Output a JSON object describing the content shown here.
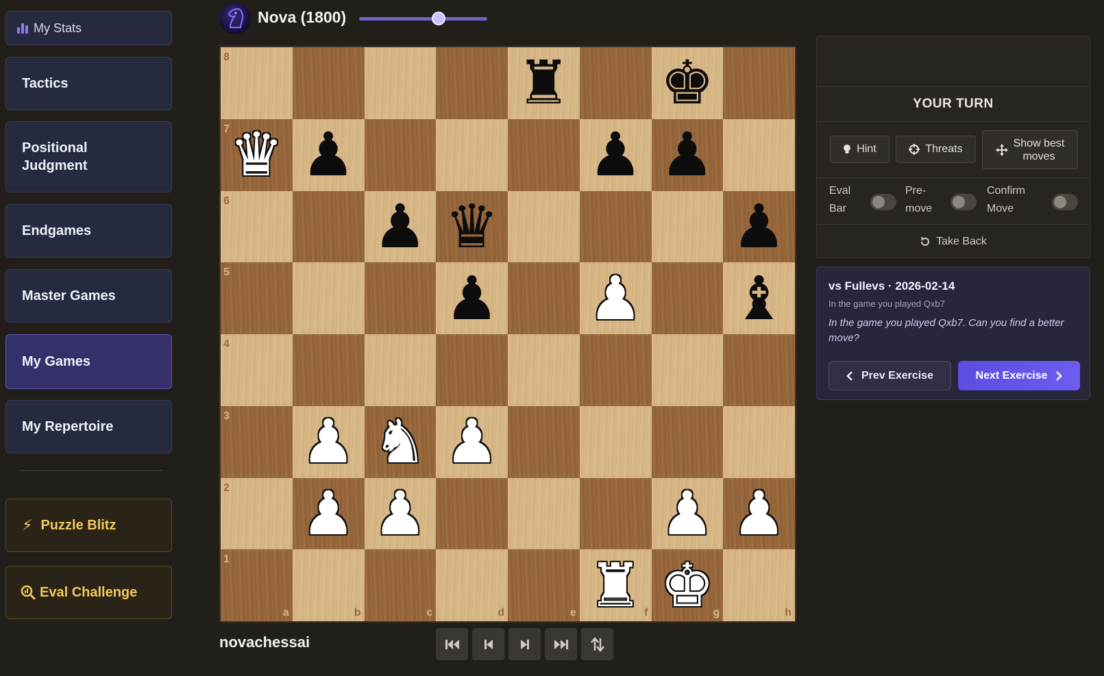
{
  "sidebar": {
    "stats_label": "My Stats",
    "items": [
      {
        "label": "Tactics"
      },
      {
        "label": "Positional Judgment"
      },
      {
        "label": "Endgames"
      },
      {
        "label": "Master Games"
      },
      {
        "label": "My Games",
        "active": true
      },
      {
        "label": "My Repertoire"
      }
    ],
    "special": [
      {
        "label": "Puzzle Blitz",
        "icon": "lightning-icon"
      },
      {
        "label": "Eval Challenge",
        "icon": "magnifier-icon"
      }
    ]
  },
  "opponent": {
    "name": "Nova (1800)",
    "strength_slider_fraction": 0.62
  },
  "player": {
    "name": "novachessai"
  },
  "board": {
    "orientation": "white",
    "files": [
      "a",
      "b",
      "c",
      "d",
      "e",
      "f",
      "g",
      "h"
    ],
    "ranks": [
      "8",
      "7",
      "6",
      "5",
      "4",
      "3",
      "2",
      "1"
    ],
    "pieces": {
      "e8": "bR",
      "g8": "bK",
      "a7": "wQ",
      "b7": "bP",
      "f7": "bP",
      "g7": "bP",
      "c6": "bP",
      "d6": "bQ",
      "h6": "bP",
      "d5": "bP",
      "f5": "wP",
      "h5": "bB",
      "b3": "wP",
      "c3": "wN",
      "d3": "wP",
      "b2": "wP",
      "c2": "wP",
      "g2": "wP",
      "h2": "wP",
      "f1": "wR",
      "g1": "wK"
    },
    "colors": {
      "light": "#d7b684",
      "dark": "#9a6a3f"
    }
  },
  "controls": [
    "first-move-icon",
    "prev-move-icon",
    "next-move-icon",
    "last-move-icon",
    "flip-board-icon"
  ],
  "panel": {
    "turn_label": "YOUR TURN",
    "hint_label": "Hint",
    "threats_label": "Threats",
    "best_moves_label_1": "Show best",
    "best_moves_label_2": "moves",
    "eval_bar_1": "Eval",
    "eval_bar_2": "Bar",
    "premove_1": "Pre-",
    "premove_2": "move",
    "confirm_1": "Confirm",
    "confirm_2": "Move",
    "take_back_label": "Take Back"
  },
  "exercise": {
    "title": "vs Fullevs · 2026-02-14",
    "subtitle": "In the game you played Qxb7",
    "prompt": "In the game you played Qxb7. Can you find a better move?",
    "prev_label": "Prev Exercise",
    "next_label": "Next Exercise"
  },
  "theme": {
    "accent": "#6d5cf0",
    "gold": "#f2c95a"
  }
}
